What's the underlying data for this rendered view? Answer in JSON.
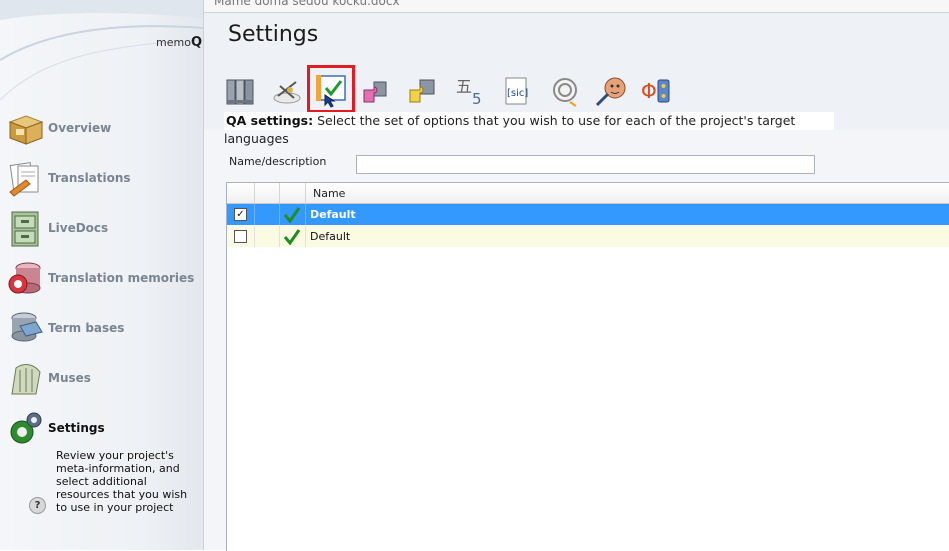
{
  "app": {
    "logo_text": "memo",
    "logo_q": "Q",
    "document_tab": "Mame doma sedou kocku.docx"
  },
  "sidebar": {
    "items": [
      {
        "label": "Overview"
      },
      {
        "label": "Translations"
      },
      {
        "label": "LiveDocs"
      },
      {
        "label": "Translation memories"
      },
      {
        "label": "Term bases"
      },
      {
        "label": "Muses"
      },
      {
        "label": "Settings"
      }
    ],
    "active": "Settings",
    "settings_description": "Review your project's meta-information, and select additional resources that you wish to use in your project",
    "help_glyph": "?"
  },
  "main": {
    "title": "Settings",
    "toolbar_icons": [
      "filter-books-icon",
      "segmentation-icon",
      "qa-settings-icon",
      "puzzle-pink-icon",
      "puzzle-yellow-icon",
      "autotranslation-icon",
      "non-translatable-icon",
      "ignore-list-icon",
      "spellcheck-icon",
      "lqa-icon"
    ],
    "selected_toolbar_icon": "qa-settings-icon",
    "qa_label": "QA settings:",
    "qa_description": "Select the set of options that you wish to use for each of the project's target languages",
    "name_label": "Name/description",
    "name_value": "",
    "grid": {
      "column_name": "Name",
      "rows": [
        {
          "checked": true,
          "checkmark": "✓",
          "name": "Default",
          "selected": true
        },
        {
          "checked": false,
          "checkmark": "",
          "name": "Default",
          "selected": false
        }
      ]
    }
  },
  "colors": {
    "selection": "#3399ff",
    "row_alt": "#fbfbe3",
    "highlight_box": "#e11b22",
    "tick_green": "#1e8f1e"
  }
}
